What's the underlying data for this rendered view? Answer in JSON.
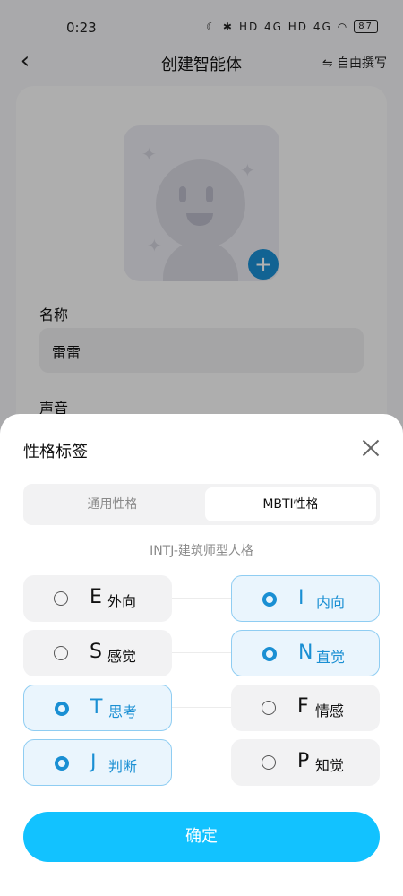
{
  "status": {
    "time": "0:23",
    "signal_text": "HD 4G HD 4G",
    "battery": "87"
  },
  "nav": {
    "title": "创建智能体",
    "free_write": "⇋ 自由撰写"
  },
  "form": {
    "name_label": "名称",
    "name_value": "雷雷",
    "voice_label": "声音"
  },
  "sheet": {
    "title": "性格标签",
    "tabs": [
      {
        "label": "通用性格"
      },
      {
        "label": "MBTI性格"
      }
    ],
    "active_tab": "MBTI性格",
    "mbti_type": "INTJ-建筑师型人格",
    "rows": [
      {
        "left": {
          "letter": "E",
          "word": "外向",
          "selected": false
        },
        "right": {
          "letter": "I",
          "word": "内向",
          "selected": true
        }
      },
      {
        "left": {
          "letter": "S",
          "word": "感觉",
          "selected": false
        },
        "right": {
          "letter": "N",
          "word": "直觉",
          "selected": true
        }
      },
      {
        "left": {
          "letter": "T",
          "word": "思考",
          "selected": true
        },
        "right": {
          "letter": "F",
          "word": "情感",
          "selected": false
        }
      },
      {
        "left": {
          "letter": "J",
          "word": "判断",
          "selected": true
        },
        "right": {
          "letter": "P",
          "word": "知觉",
          "selected": false
        }
      }
    ],
    "confirm_label": "确定"
  },
  "colors": {
    "accent": "#1a8fd3",
    "confirm": "#12c2ff",
    "selected_bg": "#eaf5fd"
  }
}
